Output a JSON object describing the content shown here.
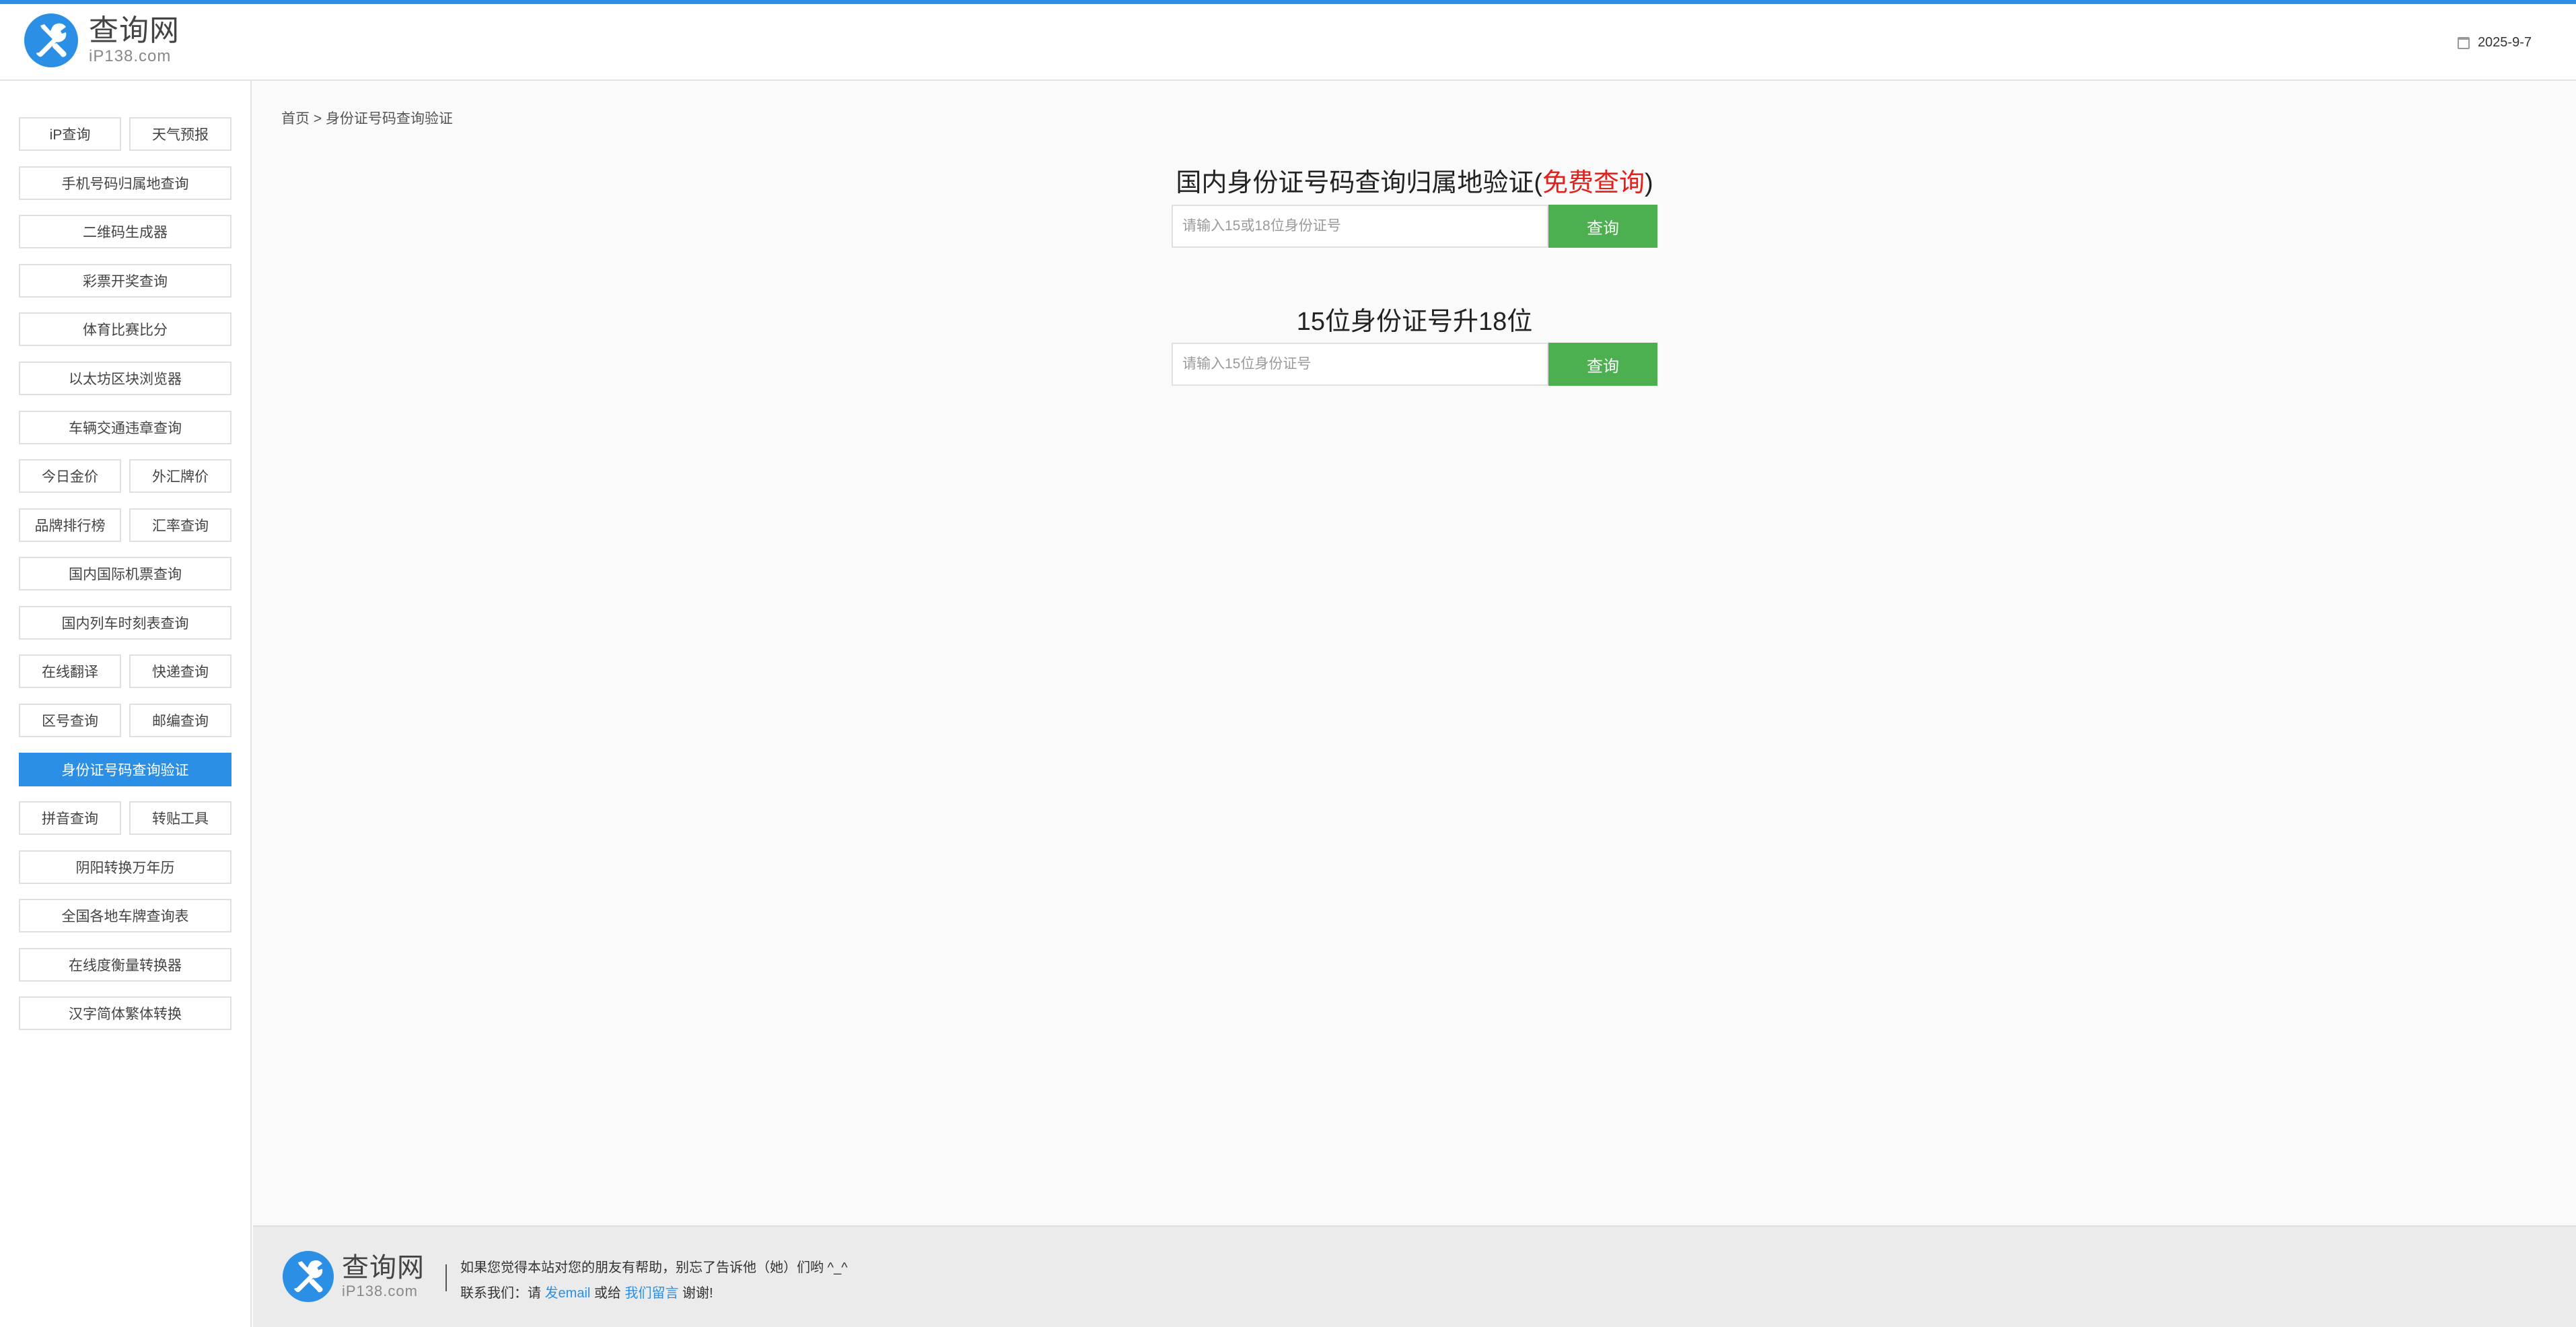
{
  "header": {
    "logo_cn": "查询网",
    "logo_en": "iP138.com",
    "date": "2025-9-7",
    "date_icon": "calendar-icon"
  },
  "sidebar": {
    "items": [
      {
        "label": "iP查询"
      },
      {
        "label": "天气预报"
      },
      {
        "label": "手机号码归属地查询"
      },
      {
        "label": "二维码生成器"
      },
      {
        "label": "彩票开奖查询"
      },
      {
        "label": "体育比赛比分"
      },
      {
        "label": "以太坊区块浏览器"
      },
      {
        "label": "车辆交通违章查询"
      },
      {
        "label": "今日金价"
      },
      {
        "label": "外汇牌价"
      },
      {
        "label": "品牌排行榜"
      },
      {
        "label": "汇率查询"
      },
      {
        "label": "国内国际机票查询"
      },
      {
        "label": "国内列车时刻表查询"
      },
      {
        "label": "在线翻译"
      },
      {
        "label": "快递查询"
      },
      {
        "label": "区号查询"
      },
      {
        "label": "邮编查询"
      },
      {
        "label": "身份证号码查询验证",
        "active": true
      },
      {
        "label": "拼音查询"
      },
      {
        "label": "转贴工具"
      },
      {
        "label": "阴阳转换万年历"
      },
      {
        "label": "全国各地车牌查询表"
      },
      {
        "label": "在线度衡量转换器"
      },
      {
        "label": "汉字简体繁体转换"
      }
    ]
  },
  "breadcrumb": {
    "home": "首页",
    "separator": " > ",
    "current": "身份证号码查询验证"
  },
  "query1": {
    "title_main": "国内身份证号码查询归属地验证(",
    "title_highlight": "免费查询",
    "title_end": ")",
    "placeholder": "请输入15或18位身份证号",
    "button": "查询"
  },
  "query2": {
    "title": "15位身份证号升18位",
    "placeholder": "请输入15位身份证号",
    "button": "查询"
  },
  "footer": {
    "logo_cn": "查询网",
    "logo_en": "iP138.com",
    "line1": "如果您觉得本站对您的朋友有帮助，别忘了告诉他（她）们哟 ^_^",
    "line2_prefix": "联系我们：请 ",
    "email_link": "发email",
    "or": " 或给 ",
    "message_link": "我们留言",
    "thanks": " 谢谢!"
  },
  "colors": {
    "accent": "#2b8fe6",
    "button_green": "#4caf50",
    "highlight_red": "#e3211c"
  }
}
